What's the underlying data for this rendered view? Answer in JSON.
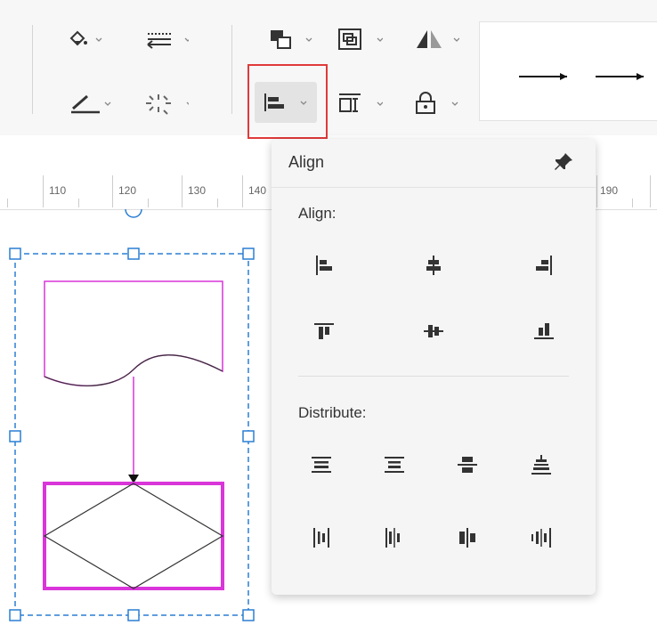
{
  "popup": {
    "title": "Align",
    "align_label": "Align:",
    "distribute_label": "Distribute:",
    "align_icons": [
      "align-left-icon",
      "align-center-icon",
      "align-right-icon",
      "align-top-icon",
      "align-middle-icon",
      "align-bottom-icon"
    ],
    "distribute_icons": [
      "distribute-vertical-1-icon",
      "distribute-vertical-2-icon",
      "distribute-vertical-3-icon",
      "distribute-vertical-4-icon",
      "distribute-horizontal-1-icon",
      "distribute-horizontal-2-icon",
      "distribute-horizontal-3-icon",
      "distribute-horizontal-4-icon"
    ]
  },
  "ruler": {
    "labels": [
      "110",
      "120",
      "130",
      "140",
      "190"
    ]
  },
  "colors": {
    "highlight_border": "#e03a3a",
    "shape_border": "#d935d9",
    "selection": "#2a7fd4"
  }
}
